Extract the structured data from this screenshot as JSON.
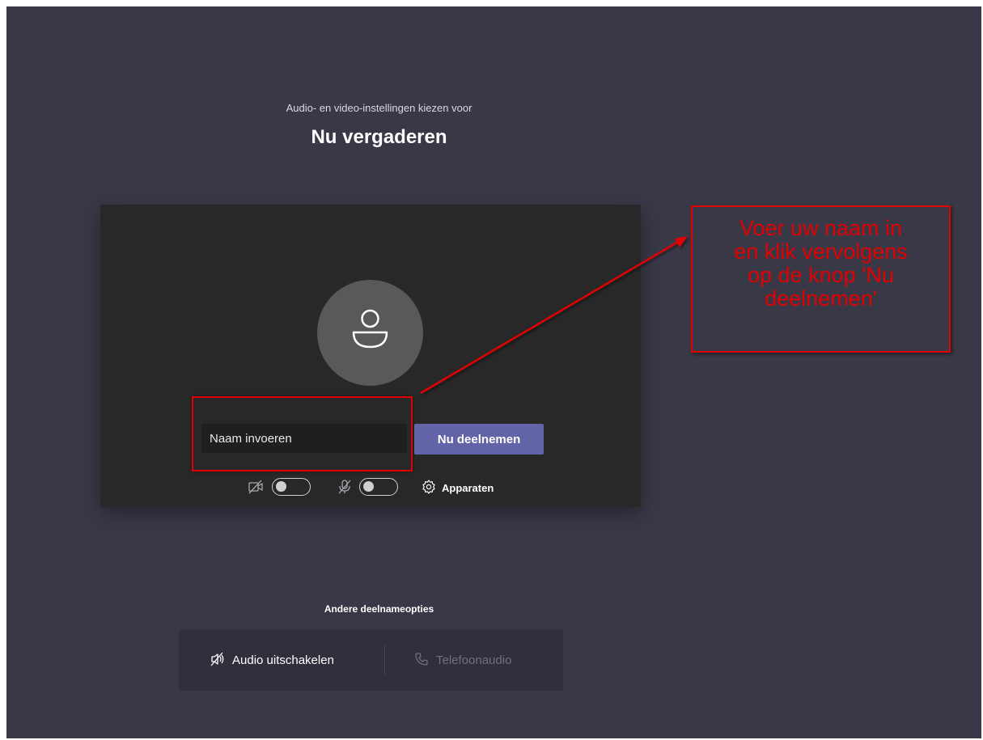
{
  "header": {
    "subtitle": "Audio- en video-instellingen kiezen voor",
    "title": "Nu vergaderen"
  },
  "prejoin": {
    "name_placeholder": "Naam invoeren",
    "join_label": "Nu deelnemen",
    "camera_toggle_on": false,
    "mic_toggle_on": false,
    "devices_label": "Apparaten"
  },
  "annotation": {
    "callout_lines": [
      "Voer uw naam in",
      "en klik vervolgens",
      "op de knop 'Nu",
      "deelnemen'"
    ],
    "color": "#e00000"
  },
  "other_options": {
    "heading": "Andere deelnameopties",
    "audio_off_label": "Audio uitschakelen",
    "phone_audio_label": "Telefoonaudio"
  },
  "colors": {
    "background": "#393847",
    "preview": "#282828",
    "accent": "#6264a7",
    "avatar": "#595959"
  }
}
